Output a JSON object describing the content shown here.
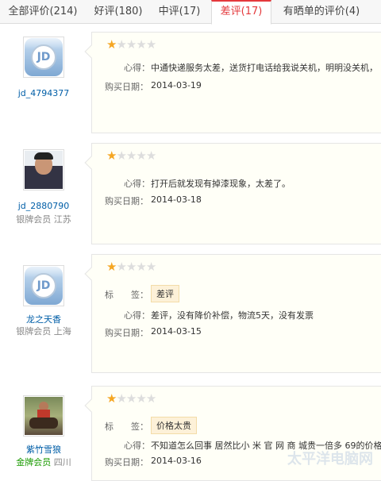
{
  "tabs": [
    {
      "label": "全部评价(214)",
      "active": false
    },
    {
      "label": "好评(180)",
      "active": false
    },
    {
      "label": "中评(17)",
      "active": false
    },
    {
      "label": "差评(17)",
      "active": true
    },
    {
      "label": "有晒单的评价(4)",
      "active": false
    }
  ],
  "labels": {
    "tag": "标　　签：",
    "comment": "心得：",
    "date": "购买日期："
  },
  "reviews": [
    {
      "user": "jd_4794377",
      "level": "",
      "location": "",
      "avatar": "jd-default",
      "rating": 1,
      "tag": "",
      "comment": "中通快递服务太差，送货打电话给我说关机，明明没关机，",
      "date": "2014-03-19"
    },
    {
      "user": "jd_2880790",
      "level": "银牌会员",
      "location": "江苏",
      "avatar": "photo",
      "rating": 1,
      "tag": "",
      "comment": "打开后就发现有掉漆现象，太差了。",
      "date": "2014-03-18"
    },
    {
      "user": "龙之天香",
      "level": "银牌会员",
      "location": "上海",
      "avatar": "jd-default",
      "rating": 1,
      "tag": "差评",
      "comment": "差评，没有降价补偿，物流5天，没有发票",
      "date": "2014-03-15"
    },
    {
      "user": "紫竹雪狼",
      "level": "金牌会员",
      "location": "四川",
      "avatar": "photo",
      "rating": 1,
      "tag": "价格太贵",
      "comment": "不知道怎么回事 居然比小 米 官 网 商 城贵一倍多 69的价格",
      "date": "2014-03-16"
    }
  ],
  "watermark": "太平洋电脑网",
  "colors": {
    "accent": "#e4393c",
    "star": "#f5a623",
    "link": "#005ea7",
    "gold_member": "#199a00"
  }
}
